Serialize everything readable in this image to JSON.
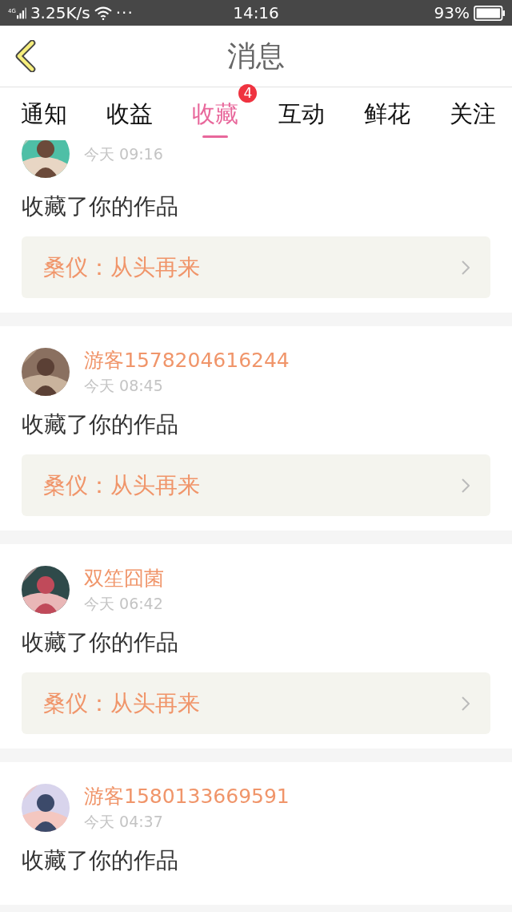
{
  "status_bar": {
    "network": "4G",
    "speed": "3.25K/s",
    "more": "···",
    "time": "14:16",
    "battery": "93%"
  },
  "header": {
    "title": "消息"
  },
  "tabs": [
    {
      "label": "通知",
      "selected": false
    },
    {
      "label": "收益",
      "selected": false
    },
    {
      "label": "收藏",
      "selected": true,
      "badge": "4"
    },
    {
      "label": "互动",
      "selected": false
    },
    {
      "label": "鲜花",
      "selected": false
    },
    {
      "label": "关注",
      "selected": false
    }
  ],
  "messages": [
    {
      "time": "今天 09:16",
      "action": "收藏了你的作品",
      "work": "桑仪：从头再来"
    },
    {
      "name": "游客1578204616244",
      "time": "今天 08:45",
      "action": "收藏了你的作品",
      "work": "桑仪：从头再来"
    },
    {
      "name": "双笙囧菌",
      "time": "今天 06:42",
      "action": "收藏了你的作品",
      "work": "桑仪：从头再来"
    },
    {
      "name": "游客1580133669591",
      "time": "今天 04:37",
      "action": "收藏了你的作品"
    }
  ]
}
